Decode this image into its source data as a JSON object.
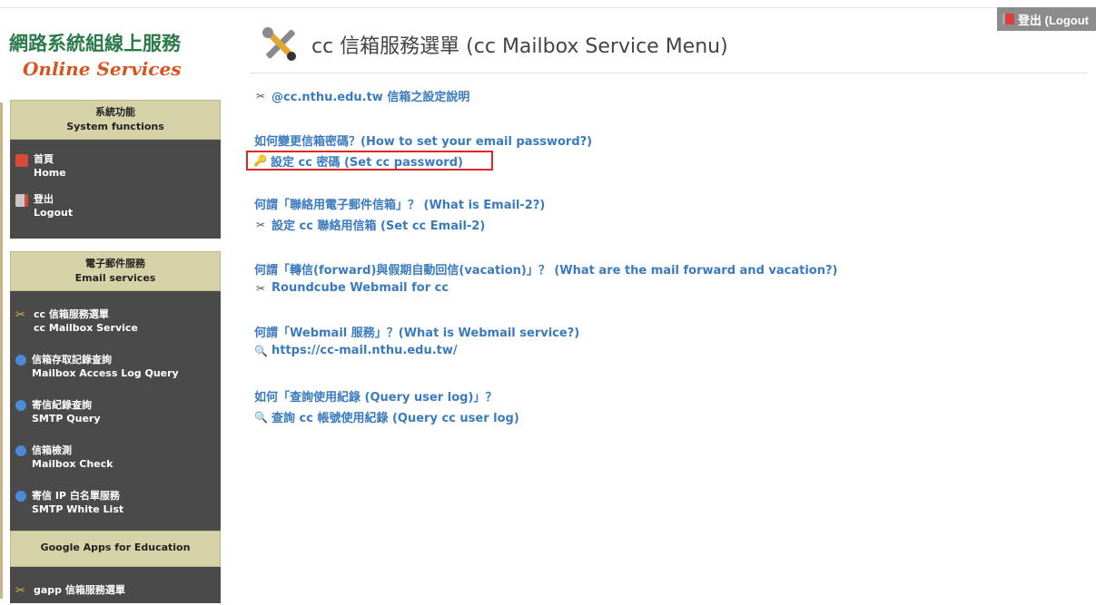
{
  "top_logout": "登出 (Logout",
  "brand": {
    "zh": "網路系統組線上服務",
    "en": "Online Services"
  },
  "sidebar": {
    "sections": [
      {
        "head_zh": "系統功能",
        "head_en": "System functions",
        "items": [
          {
            "icon": "home-icon",
            "zh": "首頁",
            "en": "Home"
          },
          {
            "icon": "logout-icon",
            "zh": "登出",
            "en": "Logout"
          }
        ]
      },
      {
        "head_zh": "電子郵件服務",
        "head_en": "Email services",
        "items": [
          {
            "icon": "tools-icon",
            "zh": "cc 信箱服務選單",
            "en": "cc Mailbox Service"
          },
          {
            "icon": "magnifier-icon",
            "zh": "信箱存取記錄查詢",
            "en": "Mailbox Access Log Query"
          },
          {
            "icon": "magnifier-icon",
            "zh": "寄信紀錄查詢",
            "en": "SMTP Query"
          },
          {
            "icon": "magnifier-icon",
            "zh": "信箱檢測",
            "en": "Mailbox Check"
          },
          {
            "icon": "magnifier-icon",
            "zh": "寄信 IP 白名單服務",
            "en": "SMTP White List"
          }
        ]
      },
      {
        "head_en": "Google Apps for Education",
        "items": [
          {
            "icon": "tools-icon",
            "zh": "gapp 信箱服務選單",
            "en": ""
          }
        ]
      }
    ]
  },
  "main": {
    "title": "cc 信箱服務選單 (cc Mailbox Service Menu)",
    "setup_link": "@cc.nthu.edu.tw 信箱之設定說明",
    "q1": "如何變更信箱密碼？(How to set your email password?)",
    "set_password": "設定 cc 密碼 (Set cc password)",
    "q2": "何謂「聯絡用電子郵件信箱」？ (What is Email-2?)",
    "set_email2": "設定 cc 聯絡用信箱 (Set cc Email-2)",
    "q3": "何謂「轉信(forward)與假期自動回信(vacation)」？ (What are the mail forward and vacation?)",
    "roundcube": "Roundcube Webmail for cc",
    "q4": "何謂「Webmail 服務」？(What is Webmail service?)",
    "webmail_url": "https://cc-mail.nthu.edu.tw/",
    "q5": "如何「查詢使用紀錄 (Query user log)」？",
    "query_log": "查詢 cc 帳號使用紀錄 (Query cc user log)"
  }
}
